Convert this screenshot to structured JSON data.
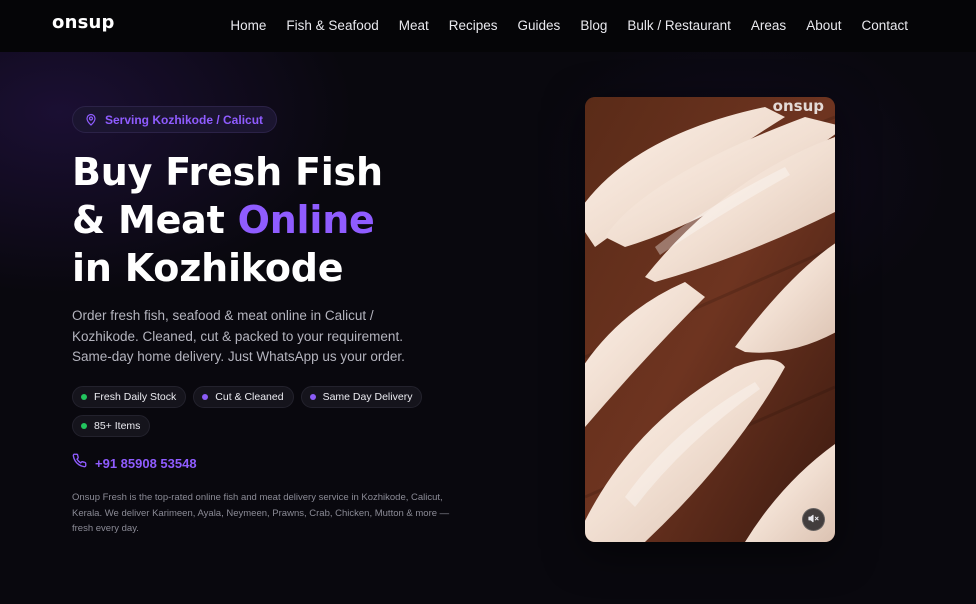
{
  "brand": {
    "logo_text": "onsup"
  },
  "nav": {
    "items": [
      {
        "label": "Home"
      },
      {
        "label": "Fish & Seafood"
      },
      {
        "label": "Meat"
      },
      {
        "label": "Recipes"
      },
      {
        "label": "Guides"
      },
      {
        "label": "Blog"
      },
      {
        "label": "Bulk / Restaurant"
      },
      {
        "label": "Areas"
      },
      {
        "label": "About"
      },
      {
        "label": "Contact"
      }
    ]
  },
  "hero": {
    "location_badge": {
      "icon": "map-pin-icon",
      "text": "Serving Kozhikode / Calicut"
    },
    "headline": {
      "line1": "Buy Fresh Fish",
      "line2_prefix": "& Meat ",
      "line2_accent": "Online",
      "line3": "in Kozhikode"
    },
    "description": "Order fresh fish, seafood & meat online in Calicut / Kozhikode. Cleaned, cut & packed to your requirement. Same-day home delivery. Just WhatsApp us your order.",
    "chips": [
      {
        "label": "Fresh Daily Stock",
        "dot_color": "#22c55e"
      },
      {
        "label": "Cut & Cleaned",
        "dot_color": "#8b5cf6"
      },
      {
        "label": "Same Day Delivery",
        "dot_color": "#8b5cf6"
      },
      {
        "label": "85+ Items",
        "dot_color": "#22c55e"
      }
    ],
    "phone": {
      "icon": "phone-icon",
      "number": "+91 85908 53548"
    },
    "footnote": "Onsup Fresh is the top-rated online fish and meat delivery service in Kozhikode, Calicut, Kerala. We deliver Karimeen, Ayala, Neymeen, Prawns, Crab, Chicken, Mutton & more — fresh every day."
  },
  "media": {
    "watermark": "onsup",
    "mute_icon": "speaker-muted-icon"
  },
  "colors": {
    "accent": "#8f5cff",
    "background": "#09080e",
    "navbar": "#050507",
    "green_dot": "#22c55e",
    "purple_dot": "#8b5cf6"
  }
}
